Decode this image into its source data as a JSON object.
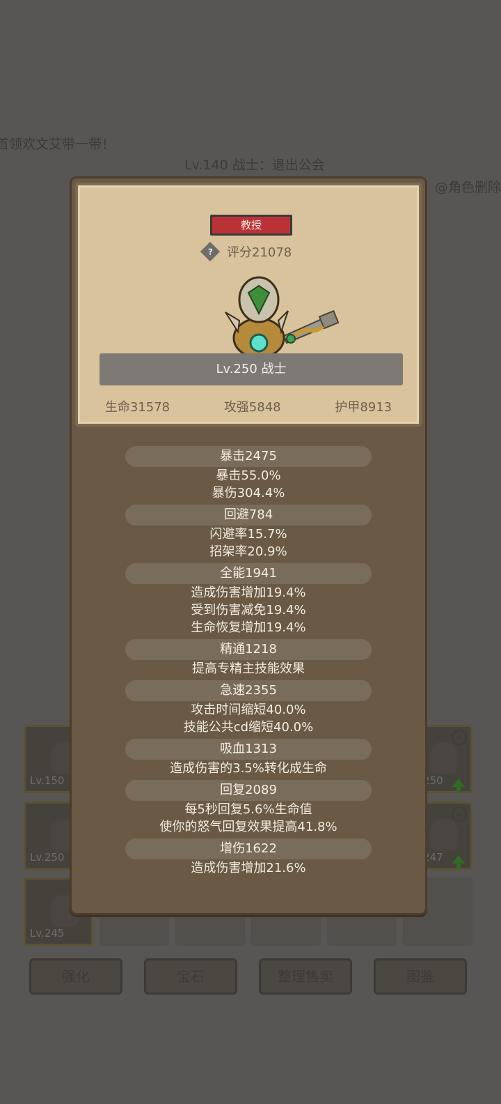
{
  "background": {
    "motto": "首领欢文艾带一带！",
    "guild_line": "Lv.140 战士：退出公会",
    "mention": "@角色删除",
    "slots": [
      {
        "level": "Lv.150",
        "locked": false,
        "upgrade": false
      },
      {
        "level": "Lv.250",
        "locked": false,
        "upgrade": false
      },
      {
        "level": "Lv.245",
        "locked": false,
        "upgrade": false
      },
      {
        "level": "250",
        "locked": true,
        "upgrade": true
      },
      {
        "level": "247",
        "locked": true,
        "upgrade": true
      }
    ],
    "buttons": [
      "强化",
      "宝石",
      "整理售卖",
      "图鉴"
    ]
  },
  "modal": {
    "title_badge": "教授",
    "score": "评分21078",
    "hero_name": "Lv.250 战士",
    "main_stats": [
      {
        "label": "生命31578"
      },
      {
        "label": "攻强5848"
      },
      {
        "label": "护甲8913"
      }
    ],
    "stat_groups": [
      {
        "head": "暴击2475",
        "lines": [
          "暴击55.0%",
          "暴伤304.4%"
        ]
      },
      {
        "head": "回避784",
        "lines": [
          "闪避率15.7%",
          "招架率20.9%"
        ]
      },
      {
        "head": "全能1941",
        "lines": [
          "造成伤害增加19.4%",
          "受到伤害减免19.4%",
          "生命恢复增加19.4%"
        ]
      },
      {
        "head": "精通1218",
        "lines": [
          "提高专精主技能效果"
        ]
      },
      {
        "head": "急速2355",
        "lines": [
          "攻击时间缩短40.0%",
          "技能公共cd缩短40.0%"
        ]
      },
      {
        "head": "吸血1313",
        "lines": [
          "造成伤害的3.5%转化成生命"
        ]
      },
      {
        "head": "回复2089",
        "lines": [
          "每5秒回复5.6%生命值",
          "使你的怒气回复效果提高41.8%"
        ]
      },
      {
        "head": "增伤1622",
        "lines": [
          "造成伤害增加21.6%"
        ]
      }
    ]
  }
}
